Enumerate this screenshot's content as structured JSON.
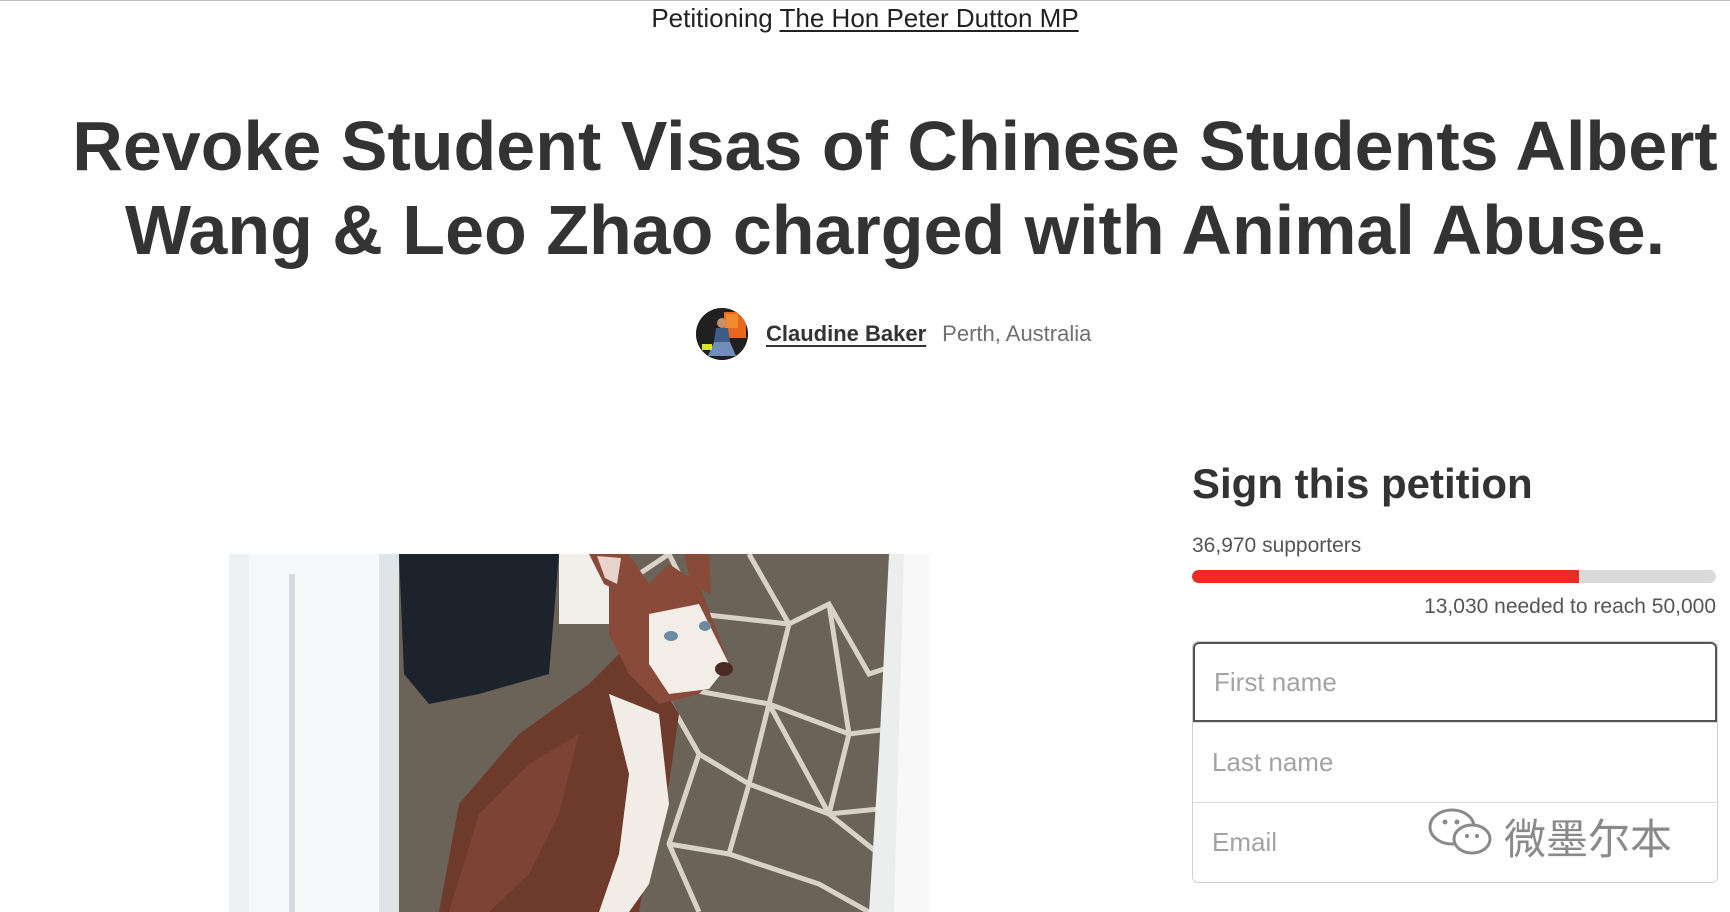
{
  "header": {
    "petitioning_prefix": "Petitioning",
    "target": "The Hon Peter Dutton MP"
  },
  "petition": {
    "title": "Revoke Student Visas of Chinese Students Albert Wang & Leo Zhao charged with Animal Abuse.",
    "author_name": "Claudine Baker",
    "author_location": "Perth, Australia"
  },
  "sign": {
    "heading": "Sign this petition",
    "supporters": "36,970 supporters",
    "needed": "13,030 needed to reach 50,000",
    "progress_fraction": 0.7394,
    "accent_color": "#ec2c22"
  },
  "form": {
    "first_name_placeholder": "First name",
    "last_name_placeholder": "Last name",
    "email_placeholder": "Email"
  },
  "watermark": {
    "text": "微墨尔本",
    "icon": "wechat-icon"
  }
}
